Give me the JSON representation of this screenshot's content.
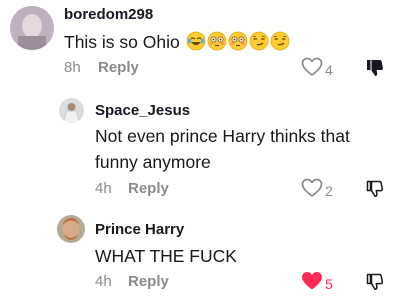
{
  "colors": {
    "accent_like": "#fe2c55",
    "muted": "#8a8b91",
    "text": "#161823"
  },
  "comments": [
    {
      "username": "boredom298",
      "text": "This is so Ohio",
      "emojis": [
        "laughing-crying",
        "flushed",
        "flushed",
        "smirk",
        "smirk"
      ],
      "time": "8h",
      "reply_label": "Reply",
      "likes": "4",
      "liked": false,
      "disliked": true
    },
    {
      "username": "Space_Jesus",
      "text_line1": "Not even prince Harry thinks that",
      "text_line2": "funny anymore",
      "time": "4h",
      "reply_label": "Reply",
      "likes": "2",
      "liked": false,
      "disliked": false
    },
    {
      "username": "Prince Harry",
      "text": "WHAT THE FUCK",
      "time": "4h",
      "reply_label": "Reply",
      "likes": "5",
      "liked": true,
      "disliked": false
    }
  ]
}
